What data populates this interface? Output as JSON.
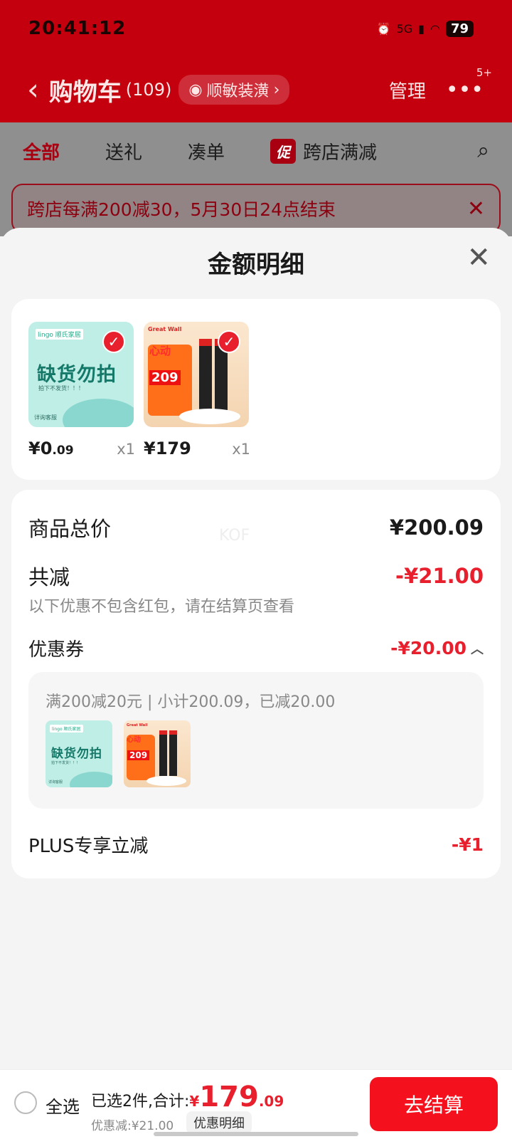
{
  "status_bar": {
    "time": "20:41:12",
    "network": "5G",
    "battery": "79"
  },
  "header": {
    "title": "购物车",
    "count": "(109)",
    "address": "顺敏装潢",
    "manage": "管理",
    "more_badge": "5+"
  },
  "tabs": [
    {
      "label": "全部",
      "active": true
    },
    {
      "label": "送礼"
    },
    {
      "label": "凑单"
    }
  ],
  "promo_tab": {
    "tag": "促",
    "label": "跨店满减"
  },
  "banner": {
    "text": "跨店每满200减30，5月30日24点结束"
  },
  "sheet": {
    "title": "金额明细",
    "products": [
      {
        "thumb_title": "缺货勿拍",
        "thumb_brand": "lingo 顺氏家居",
        "thumb_sub": "拍下不发货！！！",
        "thumb_info": "详询客服",
        "price_int": "¥0",
        "price_dec": ".09",
        "qty": "x1"
      },
      {
        "thumb_title": "心动",
        "thumb_brand": "Great Wall",
        "thumb_badge": "209",
        "price_int": "¥179",
        "price_dec": "",
        "qty": "x1"
      }
    ],
    "summary": {
      "total_label": "商品总价",
      "total_value": "¥200.09",
      "discount_label": "共减",
      "discount_value": "-¥21.00",
      "discount_note": "以下优惠不包含红包，请在结算页查看",
      "coupon_label": "优惠券",
      "coupon_value": "-¥20.00",
      "coupon_detail": "满200减20元 | 小计200.09，已减20.00",
      "plus_label": "PLUS专享立减",
      "plus_value": "-¥1"
    },
    "watermark": "KOF"
  },
  "bottom_bar": {
    "select_all": "全选",
    "selected_prefix": "已选2件,合计:",
    "currency": "¥",
    "total_int": "179",
    "total_dec": ".09",
    "discount_text": "优惠减:¥21.00",
    "detail_button": "优惠明细",
    "checkout": "去结算"
  },
  "colors": {
    "accent_red": "#e8202e",
    "header_red": "#c4000e"
  }
}
